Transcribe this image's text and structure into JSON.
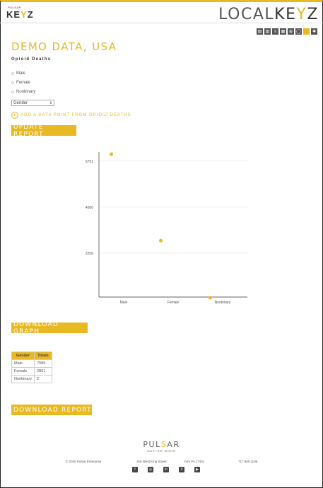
{
  "header": {
    "small_logo_top": "PULSAR",
    "small_logo_main_a": "KE",
    "small_logo_main_y": "Y",
    "small_logo_main_b": "Z",
    "big_logo_a": "LOCAL",
    "big_logo_b": "KE",
    "big_logo_y": "Y",
    "big_logo_c": "Z"
  },
  "toolbar": {
    "icons": [
      "report-icon",
      "bar-chart-icon",
      "list-icon",
      "table-icon",
      "globe-icon",
      "chat-icon",
      "active-view-icon",
      "settings-icon"
    ]
  },
  "page": {
    "title": "DEMO DATA, USA",
    "subtitle": "Opioid Deaths"
  },
  "filters": {
    "options": [
      "Male",
      "Female",
      "Nonbinary"
    ],
    "group_select_value": "Gender"
  },
  "actions": {
    "add_label": "ADD A DATA POINT FROM OPIOID DEATHS",
    "update_label": "UPDATE REPORT",
    "download_graph_label": "DOWNLOAD GRAPH",
    "download_report_label": "DOWNLOAD REPORT"
  },
  "chart_data": {
    "type": "scatter",
    "categories": [
      "Male",
      "Female",
      "Nonbinary"
    ],
    "values": [
      7089,
      2861,
      2
    ],
    "yticks": [
      "2250",
      "4500",
      "6751"
    ],
    "ylim": [
      0,
      7089
    ],
    "color": "#e8b923",
    "grid": true
  },
  "table": {
    "headers": [
      "Gender",
      "Totals"
    ],
    "rows": [
      [
        "Male",
        "7089"
      ],
      [
        "Female",
        "2861"
      ],
      [
        "Nonbinary",
        "2"
      ]
    ]
  },
  "footer": {
    "brand_a": "PUL",
    "brand_s": "S",
    "brand_b": "AR",
    "tagline": "MATTER MORE",
    "copyright": "© 2026 Pulsar Enterprise",
    "address": "255 West King Street",
    "city": "York PA 17401",
    "phone": "717.650.1196",
    "socials": [
      "facebook-icon",
      "instagram-icon",
      "linkedin-icon",
      "x-icon",
      "youtube-icon"
    ]
  }
}
